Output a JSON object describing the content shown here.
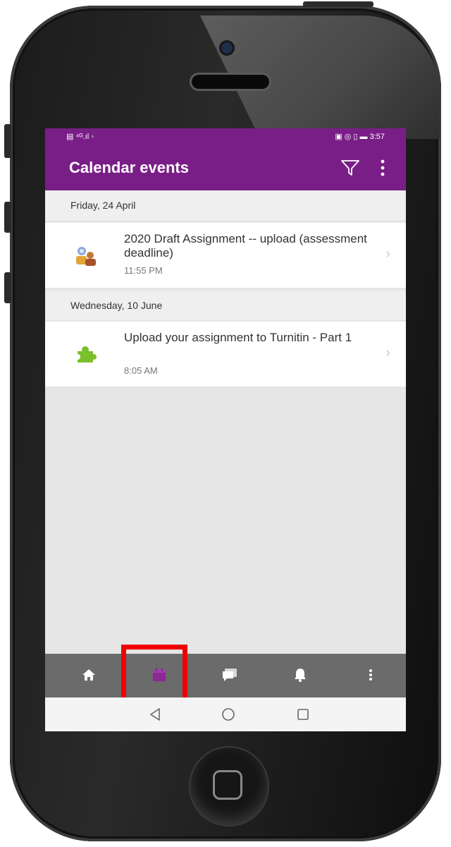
{
  "status_bar": {
    "left_text": "▤ ⁴ᴳ.ıl ◦",
    "right_text": "▣ ◎ ▯ ▬ 3:57"
  },
  "app_bar": {
    "title": "Calendar events",
    "filter_icon": "filter-icon",
    "more_icon": "more-vertical-icon"
  },
  "events": [
    {
      "day_header": "Friday, 24 April",
      "title": "2020 Draft Assignment -- upload (assessment deadline)",
      "time": "11:55 PM",
      "icon": "group-assessment-icon"
    },
    {
      "day_header": "Wednesday, 10 June",
      "title": "Upload your assignment to Turnitin - Part 1",
      "time": "8:05 AM",
      "icon": "puzzle-piece-icon"
    }
  ],
  "tab_bar": {
    "items": [
      "home-icon",
      "calendar-icon",
      "messages-icon",
      "notifications-icon",
      "more-icon"
    ],
    "active_index": 1,
    "active_color": "#7a1e87",
    "highlight_color": "#f00000"
  },
  "system_nav": [
    "back-icon",
    "home-circle-icon",
    "recents-icon"
  ],
  "colors": {
    "brand": "#7a1e87",
    "tab_bar": "#6b6b6b",
    "list_background": "#e6e6e6"
  }
}
